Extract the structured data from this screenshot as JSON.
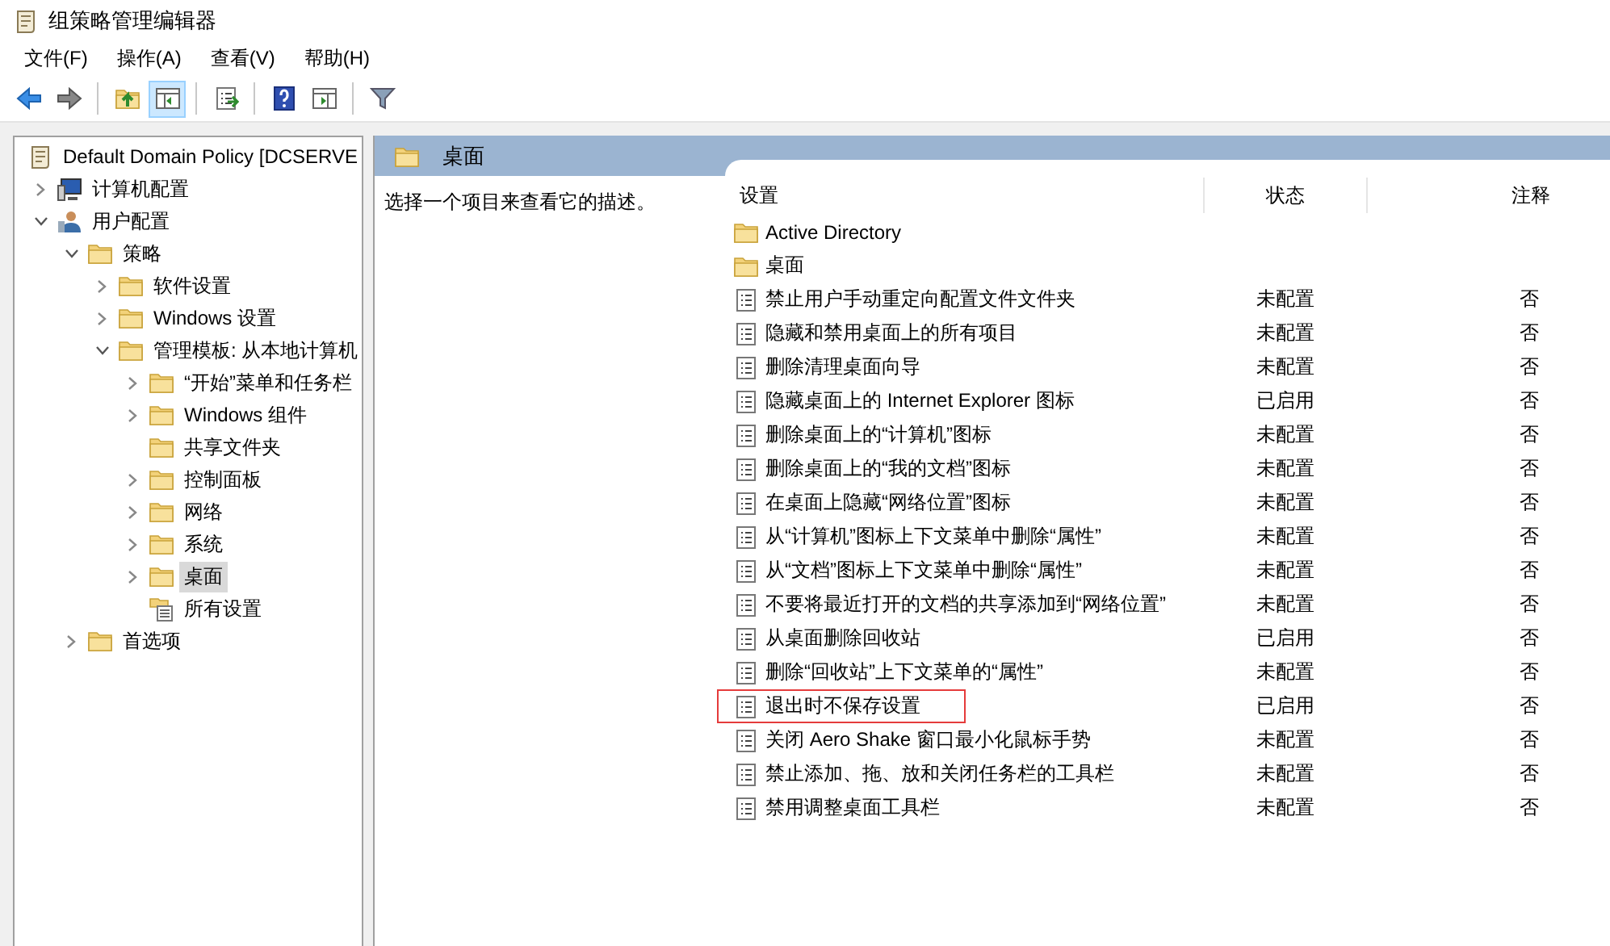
{
  "window": {
    "title": "组策略管理编辑器"
  },
  "menu": [
    "文件(F)",
    "操作(A)",
    "查看(V)",
    "帮助(H)"
  ],
  "toolbar": [
    {
      "kind": "back",
      "pressed": false
    },
    {
      "kind": "forward",
      "pressed": false
    },
    {
      "kind": "sep"
    },
    {
      "kind": "up",
      "pressed": false
    },
    {
      "kind": "tree",
      "pressed": true
    },
    {
      "kind": "sep"
    },
    {
      "kind": "export",
      "pressed": false
    },
    {
      "kind": "sep"
    },
    {
      "kind": "help",
      "pressed": false
    },
    {
      "kind": "pane",
      "pressed": false
    },
    {
      "kind": "sep"
    },
    {
      "kind": "filter",
      "pressed": false
    }
  ],
  "tree": [
    {
      "label": "Default Domain Policy [DCSERVE",
      "kind": "policy",
      "selected": false,
      "children": [
        {
          "label": "计算机配置",
          "kind": "computer",
          "expanded": false,
          "selected": false
        },
        {
          "label": "用户配置",
          "kind": "user",
          "expanded": true,
          "selected": false,
          "children": [
            {
              "label": "策略",
              "kind": "folder",
              "expanded": true,
              "selected": false,
              "children": [
                {
                  "label": "软件设置",
                  "kind": "folder",
                  "expanded": false,
                  "selected": false
                },
                {
                  "label": "Windows 设置",
                  "kind": "folder",
                  "expanded": false,
                  "selected": false
                },
                {
                  "label": "管理模板: 从本地计算机",
                  "kind": "folder",
                  "expanded": true,
                  "selected": false,
                  "children": [
                    {
                      "label": "“开始”菜单和任务栏",
                      "kind": "folder",
                      "expanded": false,
                      "selected": false
                    },
                    {
                      "label": "Windows 组件",
                      "kind": "folder",
                      "expanded": false,
                      "selected": false
                    },
                    {
                      "label": "共享文件夹",
                      "kind": "folder",
                      "selected": false
                    },
                    {
                      "label": "控制面板",
                      "kind": "folder",
                      "expanded": false,
                      "selected": false
                    },
                    {
                      "label": "网络",
                      "kind": "folder",
                      "expanded": false,
                      "selected": false
                    },
                    {
                      "label": "系统",
                      "kind": "folder",
                      "expanded": false,
                      "selected": false
                    },
                    {
                      "label": "桌面",
                      "kind": "folder",
                      "expanded": false,
                      "selected": true
                    },
                    {
                      "label": "所有设置",
                      "kind": "settings",
                      "selected": false
                    }
                  ]
                }
              ]
            },
            {
              "label": "首选项",
              "kind": "folder",
              "expanded": false,
              "selected": false
            }
          ]
        }
      ]
    }
  ],
  "detail": {
    "title": "桌面",
    "description": "选择一个项目来查看它的描述。",
    "columns": [
      "设置",
      "状态",
      "注释"
    ],
    "settings": [
      {
        "kind": "folder",
        "name": "Active Directory",
        "highlighted": false
      },
      {
        "kind": "folder",
        "name": "桌面",
        "highlighted": false
      },
      {
        "kind": "policy",
        "name": "禁止用户手动重定向配置文件文件夹",
        "state": "未配置",
        "comment": "否",
        "highlighted": false
      },
      {
        "kind": "policy",
        "name": "隐藏和禁用桌面上的所有项目",
        "state": "未配置",
        "comment": "否",
        "highlighted": false
      },
      {
        "kind": "policy",
        "name": "删除清理桌面向导",
        "state": "未配置",
        "comment": "否",
        "highlighted": false
      },
      {
        "kind": "policy",
        "name": "隐藏桌面上的 Internet Explorer 图标",
        "state": "已启用",
        "comment": "否",
        "highlighted": false
      },
      {
        "kind": "policy",
        "name": "删除桌面上的“计算机”图标",
        "state": "未配置",
        "comment": "否",
        "highlighted": false
      },
      {
        "kind": "policy",
        "name": "删除桌面上的“我的文档”图标",
        "state": "未配置",
        "comment": "否",
        "highlighted": false
      },
      {
        "kind": "policy",
        "name": "在桌面上隐藏“网络位置”图标",
        "state": "未配置",
        "comment": "否",
        "highlighted": false
      },
      {
        "kind": "policy",
        "name": "从“计算机”图标上下文菜单中删除“属性”",
        "state": "未配置",
        "comment": "否",
        "highlighted": false
      },
      {
        "kind": "policy",
        "name": "从“文档”图标上下文菜单中删除“属性”",
        "state": "未配置",
        "comment": "否",
        "highlighted": false
      },
      {
        "kind": "policy",
        "name": "不要将最近打开的文档的共享添加到“网络位置”",
        "state": "未配置",
        "comment": "否",
        "highlighted": false
      },
      {
        "kind": "policy",
        "name": "从桌面删除回收站",
        "state": "已启用",
        "comment": "否",
        "highlighted": false
      },
      {
        "kind": "policy",
        "name": "删除“回收站”上下文菜单的“属性”",
        "state": "未配置",
        "comment": "否",
        "highlighted": false
      },
      {
        "kind": "policy",
        "name": "退出时不保存设置",
        "state": "已启用",
        "comment": "否",
        "highlighted": true
      },
      {
        "kind": "policy",
        "name": "关闭 Aero Shake 窗口最小化鼠标手势",
        "state": "未配置",
        "comment": "否",
        "highlighted": false
      },
      {
        "kind": "policy",
        "name": "禁止添加、拖、放和关闭任务栏的工具栏",
        "state": "未配置",
        "comment": "否",
        "highlighted": false
      },
      {
        "kind": "policy",
        "name": "禁用调整桌面工具栏",
        "state": "未配置",
        "comment": "否",
        "highlighted": false
      }
    ]
  }
}
